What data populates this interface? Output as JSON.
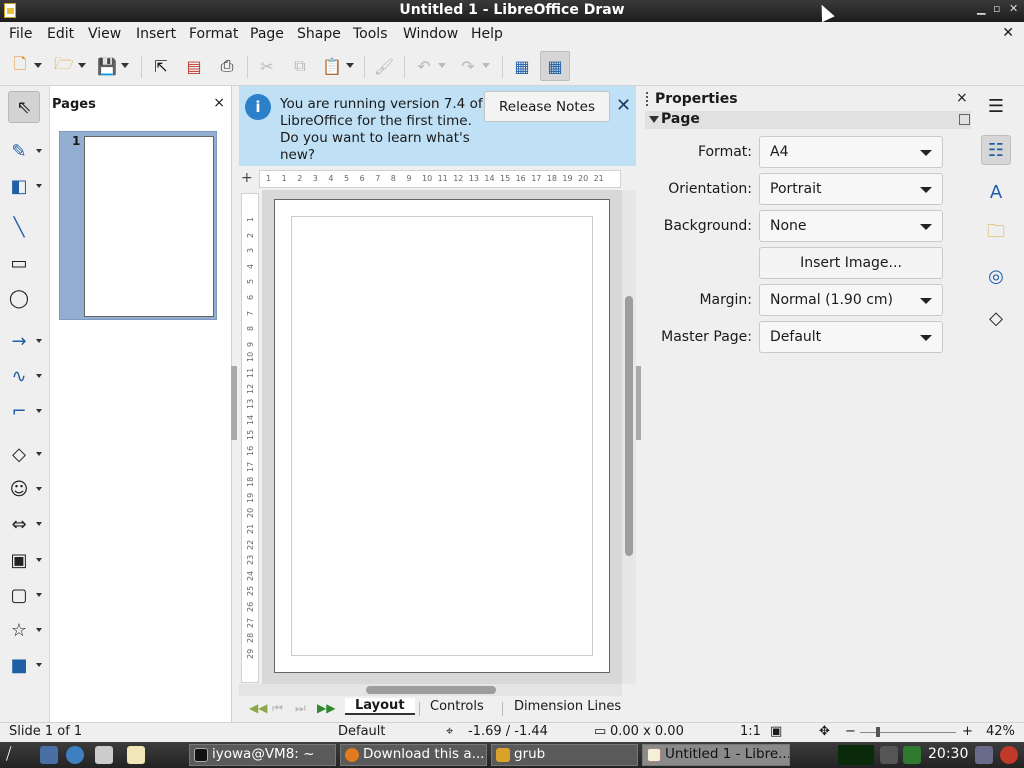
{
  "window": {
    "title": "Untitled 1 - LibreOffice Draw"
  },
  "menu": [
    "File",
    "Edit",
    "View",
    "Insert",
    "Format",
    "Page",
    "Shape",
    "Tools",
    "Window",
    "Help"
  ],
  "toolbar": {
    "icons": [
      "new-document-icon",
      "open-folder-icon",
      "save-icon",
      "export-icon",
      "export-pdf-icon",
      "print-icon",
      "cut-icon",
      "copy-icon",
      "paste-icon",
      "clone-formatting-icon",
      "undo-icon",
      "redo-icon",
      "grid-icon",
      "helplines-icon"
    ]
  },
  "left_tools": [
    "select-icon",
    "line-color-icon",
    "fill-color-icon",
    "line-icon",
    "rectangle-icon",
    "ellipse-icon",
    "arrow-line-icon",
    "curve-icon",
    "connector-icon",
    "basic-shapes-icon",
    "symbol-shapes-icon",
    "block-arrows-icon",
    "flowchart-icon",
    "callouts-icon",
    "stars-icon",
    "3d-objects-icon"
  ],
  "pages_panel": {
    "title": "Pages",
    "close": "×",
    "thumbnail_number": "1"
  },
  "infobar": {
    "message": "You are running version 7.4 of LibreOffice for the first time. Do you want to learn what's new?",
    "button": "Release Notes",
    "close": "✕"
  },
  "ruler": {
    "h_numbers": [
      "1",
      "1",
      "2",
      "3",
      "4",
      "5",
      "6",
      "7",
      "8",
      "9",
      "10",
      "11",
      "12",
      "13",
      "14",
      "15",
      "16",
      "17",
      "18",
      "19",
      "20",
      "21"
    ],
    "v_numbers": [
      "1",
      "2",
      "3",
      "4",
      "5",
      "6",
      "7",
      "8",
      "9",
      "10",
      "11",
      "12",
      "13",
      "14",
      "15",
      "16",
      "17",
      "18",
      "19",
      "20",
      "21",
      "22",
      "23",
      "24",
      "25",
      "26",
      "27",
      "28",
      "29"
    ]
  },
  "layer_tabs": {
    "tabs": [
      "Layout",
      "Controls",
      "Dimension Lines"
    ],
    "active": "Layout"
  },
  "sidebar": {
    "title": "Properties",
    "close": "×",
    "section": "Page",
    "fields": [
      {
        "label": "Format:",
        "value": "A4"
      },
      {
        "label": "Orientation:",
        "value": "Portrait"
      },
      {
        "label": "Background:",
        "value": "None"
      },
      {
        "label": "Margin:",
        "value": "Normal (1.90 cm)"
      },
      {
        "label": "Master Page:",
        "value": "Default"
      }
    ],
    "insert_image": "Insert Image...",
    "deck_icons": [
      "menu-icon",
      "properties-icon",
      "styles-icon",
      "gallery-icon",
      "navigator-icon",
      "shapes-icon"
    ]
  },
  "status": {
    "slide": "Slide 1 of 1",
    "master": "Default",
    "position": "-1.69 / -1.44",
    "size": "0.00 x 0.00",
    "scale": "1:1",
    "zoom": "42%"
  },
  "taskbar": {
    "tasks": [
      "iyowa@VM8: ~",
      "Download this a...",
      "grub",
      "Untitled 1 - Libre..."
    ],
    "clock": "20:30"
  },
  "colors": {
    "infobar_bg": "#bfe0f5",
    "accent": "#1f5fa6",
    "thumb_selected": "#94aed1"
  }
}
